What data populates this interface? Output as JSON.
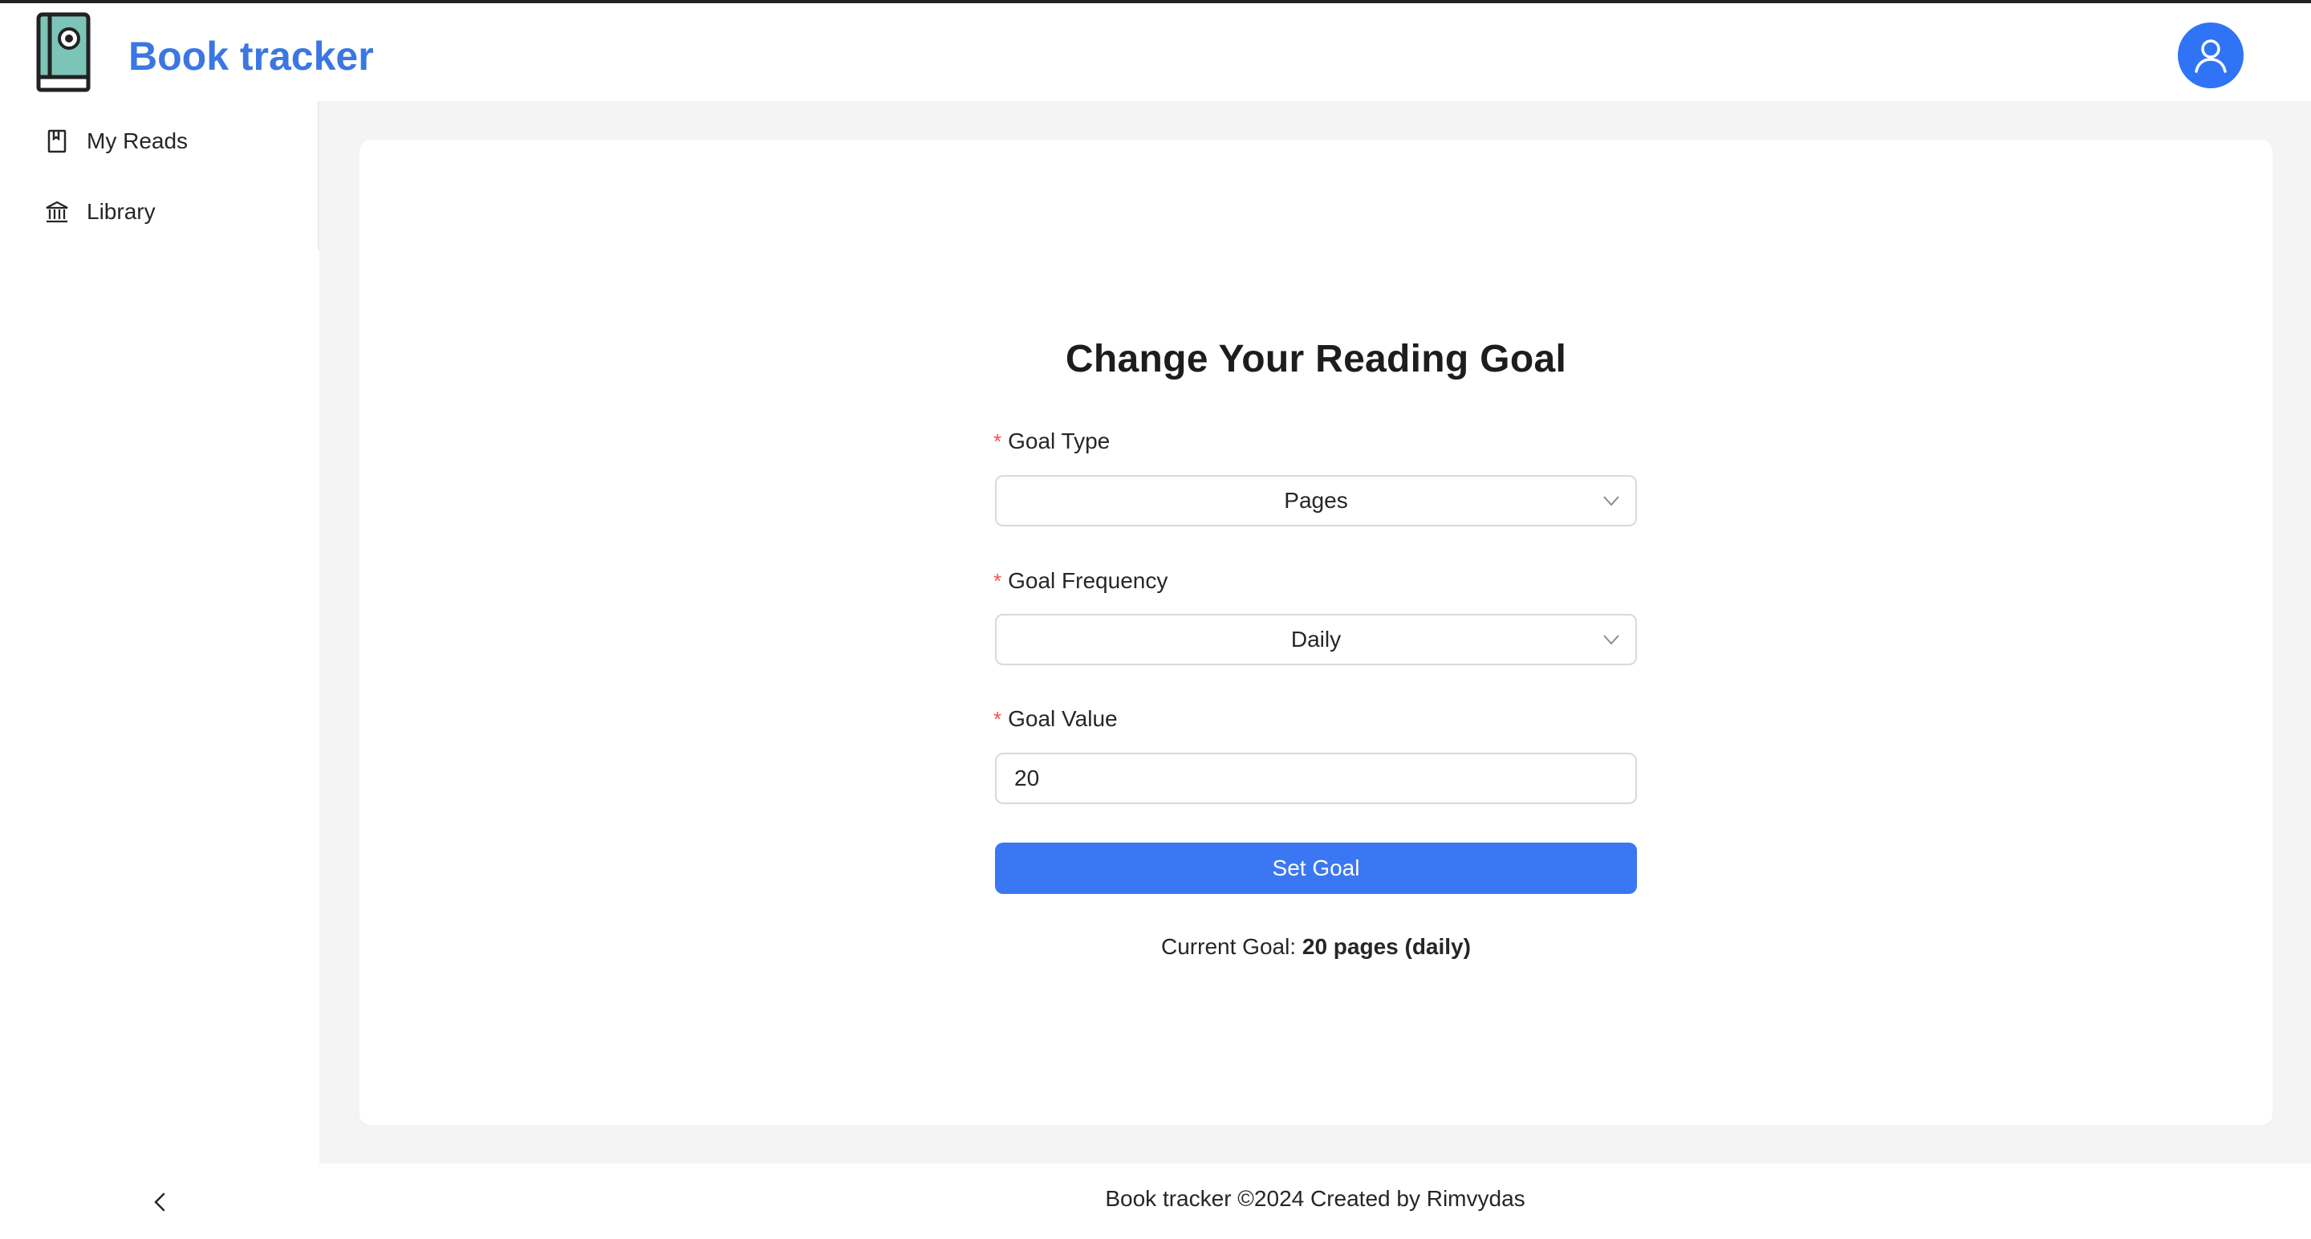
{
  "header": {
    "brand": "Book tracker",
    "logo_icon": "book-logo-icon",
    "avatar_icon": "user-icon",
    "accent": "#3b77e3"
  },
  "sidebar": {
    "items": [
      {
        "label": "My Reads",
        "icon": "book-icon"
      },
      {
        "label": "Library",
        "icon": "bank-icon"
      }
    ],
    "collapse_icon": "chevron-left-icon"
  },
  "form": {
    "title": "Change Your Reading Goal",
    "required_mark": "*",
    "goal_type": {
      "label": "Goal Type",
      "value": "Pages"
    },
    "goal_frequency": {
      "label": "Goal Frequency",
      "value": "Daily"
    },
    "goal_value": {
      "label": "Goal Value",
      "value": "20"
    },
    "submit_label": "Set Goal",
    "submit_color": "#3b77f3"
  },
  "current_goal": {
    "prefix": "Current Goal: ",
    "value": "20 pages (daily)"
  },
  "footer": {
    "text": "Book tracker ©2024 Created by Rimvydas"
  }
}
